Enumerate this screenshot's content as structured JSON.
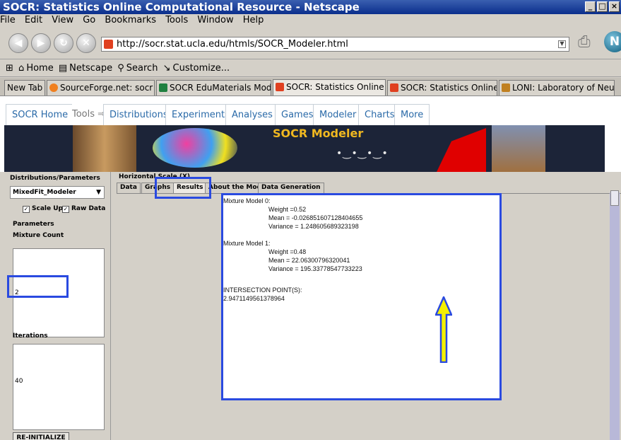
{
  "window": {
    "title": "SOCR: Statistics Online Computational Resource - Netscape"
  },
  "menu": [
    "File",
    "Edit",
    "View",
    "Go",
    "Bookmarks",
    "Tools",
    "Window",
    "Help"
  ],
  "url": "http://socr.stat.ucla.edu/htmls/SOCR_Modeler.html",
  "bookmarks": {
    "home": "Home",
    "netscape": "Netscape",
    "search": "Search",
    "customize": "Customize..."
  },
  "browser_tabs": [
    "New Tab",
    "SourceForge.net: socr P...",
    "SOCR EduMaterials Mod...",
    "SOCR: Statistics Online ...",
    "SOCR: Statistics Online ...",
    "LONI: Laboratory of Neu..."
  ],
  "site_nav": {
    "home": "SOCR Home",
    "tools": "Tools ⇒",
    "items": [
      "Distributions",
      "Experiments",
      "Analyses",
      "Games",
      "Modeler",
      "Charts",
      "More"
    ]
  },
  "banner": {
    "title": "SOCR Modeler"
  },
  "left_panel": {
    "header": "Distributions/Parameters",
    "model_select": "MixedFit_Modeler",
    "scale_up": "Scale Up",
    "raw_data": "Raw Data",
    "parameters_label": "Parameters",
    "mixture_count_label": "Mixture Count",
    "mixture_count_value": "2",
    "iterations_label": "Iterations",
    "iterations_value": "40",
    "reinit_button": "RE-INITIALIZE"
  },
  "scale_label": "Horizontal Scale (X)",
  "app_tabs": [
    "Data",
    "Graphs",
    "Results",
    "About the Model",
    "Data Generation"
  ],
  "selected_tab": "Results",
  "results": {
    "m0_title": "Mixture Model 0:",
    "m0_weight": "Weight =0.52",
    "m0_mean": "Mean = -0.026851607128404655",
    "m0_var": "Variance = 1.248605689323198",
    "m1_title": "Mixture Model 1:",
    "m1_weight": "Weight =0.48",
    "m1_mean": "Mean = 22.06300796320041",
    "m1_var": "Variance = 195.33778547733223",
    "intersection_label": "INTERSECTION POINT(S):",
    "intersection_value": "2.9471149561378964"
  },
  "colors": {
    "highlight": "#2a4ae0",
    "arrow_fill": "#f5f000"
  }
}
